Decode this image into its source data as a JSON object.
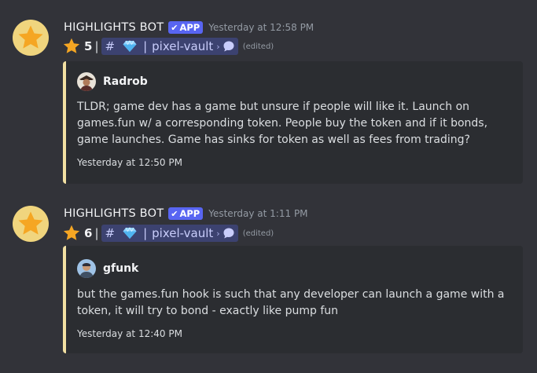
{
  "messages": [
    {
      "bot_name": "HIGHLIGHTS BOT",
      "app_badge": "APP",
      "timestamp": "Yesterday at 12:58 PM",
      "star_count": "5",
      "separator": "|",
      "channel_hash": "#",
      "channel_pipe": "|",
      "channel_name": "pixel-vault",
      "chip_arrow": "›",
      "edited_label": "(edited)",
      "embed": {
        "author": "Radrob",
        "text": "TLDR; game dev has a game but unsure if people will like it. Launch on games.fun w/ a corresponding token. People buy the token and if it bonds, game launches. Game has sinks for token as well as fees from trading?",
        "footer_time": "Yesterday at 12:50 PM",
        "accent_color": "#f2e0a2"
      }
    },
    {
      "bot_name": "HIGHLIGHTS BOT",
      "app_badge": "APP",
      "timestamp": "Yesterday at 1:11 PM",
      "star_count": "6",
      "separator": "|",
      "channel_hash": "#",
      "channel_pipe": "|",
      "channel_name": "pixel-vault",
      "chip_arrow": "›",
      "edited_label": "(edited)",
      "embed": {
        "author": "gfunk",
        "text": "but the games.fun hook is such that any developer can launch a game with a token, it will try to bond - exactly like pump fun",
        "footer_time": "Yesterday at 12:40 PM",
        "accent_color": "#f2e0a2"
      }
    }
  ],
  "icons": {
    "bot_avatar": "star-icon",
    "reaction_star": "star-icon",
    "channel_emoji": "gem-icon",
    "thread": "speech-bubble-icon",
    "app_check": "checkmark-icon"
  },
  "colors": {
    "background": "#323339",
    "embed_background": "#2b2d31",
    "app_badge": "#5865f2",
    "channel_chip": "#3c4270",
    "star": "#f5a623"
  }
}
